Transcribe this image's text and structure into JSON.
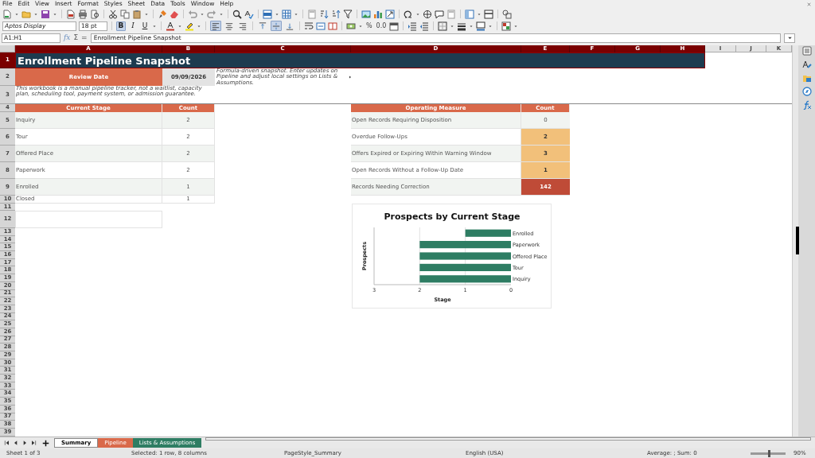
{
  "menu_bar": [
    "File",
    "Edit",
    "View",
    "Insert",
    "Format",
    "Styles",
    "Sheet",
    "Data",
    "Tools",
    "Window",
    "Help"
  ],
  "format_toolbar": {
    "font_name": "Aptos Display",
    "font_size": "18 pt",
    "text_buttons": [
      {
        "label": "B",
        "kind": "bold",
        "selected": true
      },
      {
        "label": "I",
        "kind": "italic",
        "selected": false
      },
      {
        "label": "U",
        "kind": "underline",
        "selected": false
      }
    ],
    "alignment_buttons": [
      {
        "kind": "left",
        "selected": true
      },
      {
        "kind": "center",
        "selected": false
      },
      {
        "kind": "right",
        "selected": false
      },
      {
        "kind": "top",
        "selected": false
      },
      {
        "kind": "middle",
        "selected": true
      },
      {
        "kind": "bottom",
        "selected": false
      }
    ],
    "number_buttons": [
      "%",
      "0.0"
    ]
  },
  "formula_bar": {
    "name_box": "A1:H1",
    "buttons": [
      "fx",
      "Σ",
      "="
    ],
    "content": "Enrollment Pipeline Snapshot"
  },
  "column_headers": [
    {
      "label": "A",
      "selected": true
    },
    {
      "label": "B",
      "selected": true
    },
    {
      "label": "C",
      "selected": true
    },
    {
      "label": "D",
      "selected": true
    },
    {
      "label": "E",
      "selected": true
    },
    {
      "label": "F",
      "selected": true
    },
    {
      "label": "G",
      "selected": true
    },
    {
      "label": "H",
      "selected": true
    },
    {
      "label": "I",
      "selected": false
    },
    {
      "label": "J",
      "selected": false
    },
    {
      "label": "K",
      "selected": false
    }
  ],
  "row_headers": [
    {
      "label": "1",
      "selected": true
    },
    {
      "label": "2",
      "selected": false
    },
    {
      "label": "3",
      "selected": false
    },
    {
      "label": "4",
      "selected": false
    },
    {
      "label": "5",
      "selected": false
    },
    {
      "label": "6",
      "selected": false
    },
    {
      "label": "7",
      "selected": false
    },
    {
      "label": "8",
      "selected": false
    },
    {
      "label": "9",
      "selected": false
    },
    {
      "label": "10",
      "selected": false
    },
    {
      "label": "11",
      "selected": false
    },
    {
      "label": "12",
      "selected": false
    },
    {
      "label": "13",
      "selected": false
    },
    {
      "label": "14",
      "selected": false
    },
    {
      "label": "15",
      "selected": false
    },
    {
      "label": "16",
      "selected": false
    },
    {
      "label": "17",
      "selected": false
    },
    {
      "label": "18",
      "selected": false
    },
    {
      "label": "19",
      "selected": false
    },
    {
      "label": "20",
      "selected": false
    },
    {
      "label": "21",
      "selected": false
    },
    {
      "label": "22",
      "selected": false
    },
    {
      "label": "23",
      "selected": false
    },
    {
      "label": "24",
      "selected": false
    },
    {
      "label": "25",
      "selected": false
    },
    {
      "label": "26",
      "selected": false
    },
    {
      "label": "27",
      "selected": false
    },
    {
      "label": "28",
      "selected": false
    },
    {
      "label": "29",
      "selected": false
    },
    {
      "label": "30",
      "selected": false
    },
    {
      "label": "31",
      "selected": false
    },
    {
      "label": "32",
      "selected": false
    },
    {
      "label": "33",
      "selected": false
    },
    {
      "label": "34",
      "selected": false
    },
    {
      "label": "35",
      "selected": false
    },
    {
      "label": "36",
      "selected": false
    },
    {
      "label": "37",
      "selected": false
    },
    {
      "label": "38",
      "selected": false
    },
    {
      "label": "39",
      "selected": false
    }
  ],
  "sheet": {
    "title": "Enrollment Pipeline Snapshot",
    "review_date_label": "Review Date",
    "review_date": "09/09/2026",
    "note": "Formula-driven snapshot. Enter updates on Pipeline and adjust local settings on Lists & Assumptions.",
    "disclaimer": "This workbook is a manual pipeline tracker, not a waitlist, capacity plan, scheduling tool, payment system, or admission guarantee.",
    "stage_table": {
      "columns": [
        "Current Stage",
        "Count"
      ],
      "rows": [
        {
          "stage": "Inquiry",
          "count": "2"
        },
        {
          "stage": "Tour",
          "count": "2"
        },
        {
          "stage": "Offered Place",
          "count": "2"
        },
        {
          "stage": "Paperwork",
          "count": "2"
        },
        {
          "stage": "Enrolled",
          "count": "1"
        },
        {
          "stage": "Closed",
          "count": "1"
        }
      ]
    },
    "measure_table": {
      "columns": [
        "Operating Measure",
        "Count"
      ],
      "rows": [
        {
          "measure": "Open Records Requiring Disposition",
          "count": "0",
          "color": "#f1f4f1"
        },
        {
          "measure": "Overdue Follow-Ups",
          "count": "2",
          "color": "#f2c07a"
        },
        {
          "measure": "Offers Expired or Expiring Within Warning Window",
          "count": "3",
          "color": "#f2c07a"
        },
        {
          "measure": "Open Records Without a Follow-Up Date",
          "count": "1",
          "color": "#f2c07a"
        },
        {
          "measure": "Records Needing Correction",
          "count": "142",
          "color": "#bf4b37"
        }
      ]
    },
    "chart": {
      "chart_data": {
        "type": "bar",
        "orientation": "horizontal",
        "title": "Prospects by Current Stage",
        "xlabel": "Stage",
        "ylabel": "Prospects",
        "categories": [
          "Enrolled",
          "Paperwork",
          "Offered Place",
          "Tour",
          "Inquiry"
        ],
        "series": [
          {
            "color": "#2e7d63",
            "values": [
              1,
              2,
              2,
              2,
              2
            ]
          }
        ],
        "xlim": [
          3,
          0
        ],
        "xticks": [
          3,
          2,
          1,
          0
        ]
      }
    }
  },
  "sheet_tabs": [
    {
      "label": "Summary",
      "selected": true,
      "color": "#ffffff"
    },
    {
      "label": "Pipeline",
      "selected": false,
      "color": "#d9694a"
    },
    {
      "label": "Lists & Assumptions",
      "selected": false,
      "color": "#2e7d63"
    }
  ],
  "status_bar": {
    "sheet": "Sheet 1 of 3",
    "selection": "Selected: 1 row, 8 columns",
    "page_style": "PageStyle_Summary",
    "language": "English (USA)",
    "summary": "Average: ; Sum: 0",
    "zoom_slider": {
      "level": 0.5
    },
    "zoom": "90%"
  }
}
